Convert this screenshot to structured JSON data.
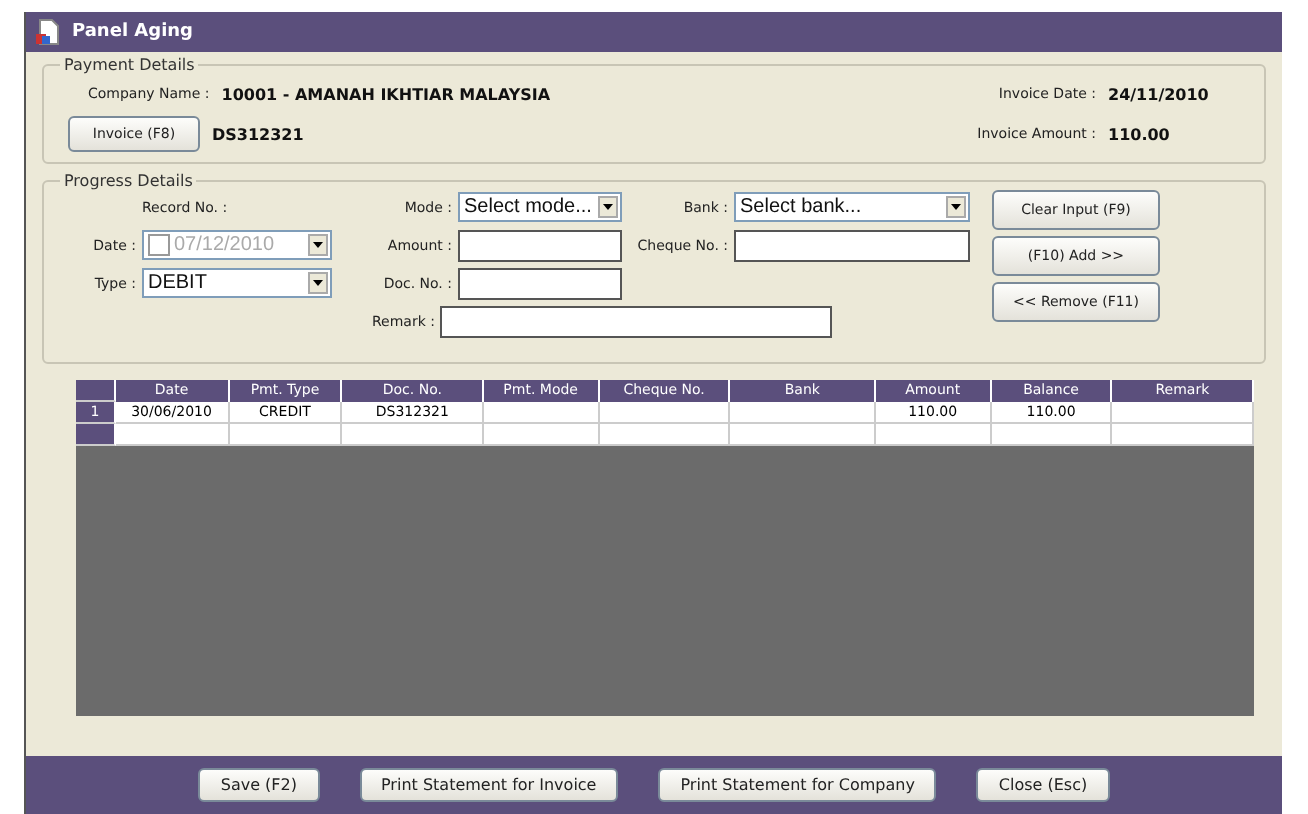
{
  "window": {
    "title": "Panel Aging"
  },
  "payment_details": {
    "title": "Payment Details",
    "company_label": "Company Name :",
    "company_value": "10001 - AMANAH IKHTIAR MALAYSIA",
    "invoice_button": "Invoice (F8)",
    "invoice_value": "DS312321",
    "invoice_date_label": "Invoice Date :",
    "invoice_date_value": "24/11/2010",
    "invoice_amount_label": "Invoice Amount :",
    "invoice_amount_value": "110.00"
  },
  "progress_details": {
    "title": "Progress Details",
    "record_label": "Record No. :",
    "date_label": "Date :",
    "date": {
      "value": "07/12/2010",
      "checked": false,
      "disabled": true
    },
    "type_label": "Type :",
    "type_value": "DEBIT",
    "mode_label": "Mode :",
    "mode_placeholder": "Select mode...",
    "amount_label": "Amount :",
    "doc_label": "Doc. No. :",
    "remark_label": "Remark :",
    "bank_label": "Bank :",
    "bank_placeholder": "Select bank...",
    "cheque_label": "Cheque No. :",
    "buttons": [
      "Clear Input (F9)",
      "(F10) Add >>",
      "<< Remove (F11)"
    ]
  },
  "table": {
    "columns": [
      "Date",
      "Pmt. Type",
      "Doc. No.",
      "Pmt. Mode",
      "Cheque No.",
      "Bank",
      "Amount",
      "Balance",
      "Remark"
    ],
    "rows": [
      {
        "number": "1",
        "cells": [
          "30/06/2010",
          "CREDIT",
          "DS312321",
          "",
          "",
          "",
          "110.00",
          "110.00",
          ""
        ]
      }
    ]
  },
  "footer_buttons": [
    "Save (F2)",
    "Print Statement for Invoice",
    "Print Statement for Company",
    "Close (Esc)"
  ]
}
